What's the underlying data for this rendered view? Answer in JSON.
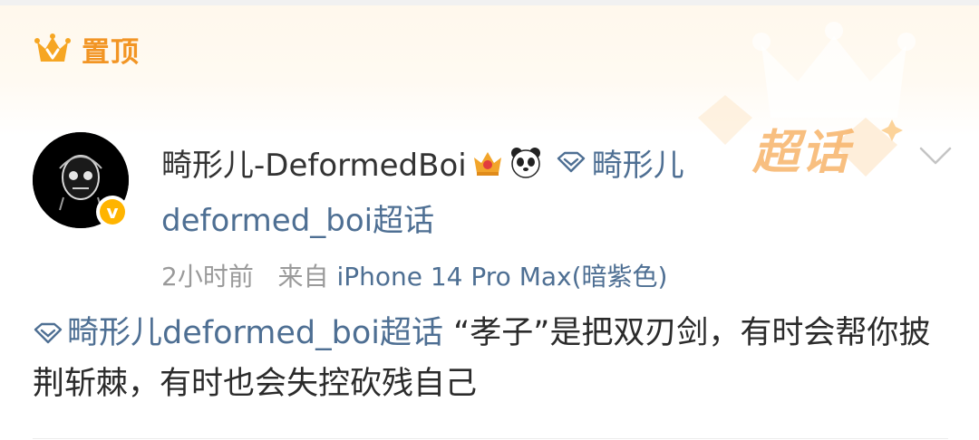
{
  "pin": {
    "label": "置顶"
  },
  "user": {
    "name": "畸形儿-DeformedBoi",
    "topic_part1": "畸形儿",
    "topic_part2": "deformed_boi超话"
  },
  "watermark": {
    "text": "超话"
  },
  "meta": {
    "time": "2小时前",
    "from_label": "来自",
    "device": "iPhone 14 Pro Max(暗紫色)"
  },
  "post": {
    "topic_tag": "畸形儿deformed_boi超话",
    "text": "“孝子”是把双刃剑，有时会帮你披荆斩棘，有时也会失控砍残自己"
  },
  "colors": {
    "accent": "#f29524",
    "link": "#4e6f93",
    "text": "#2b2b2b",
    "meta": "#9a9a9a"
  },
  "icons": [
    "crown-icon",
    "avatar-image",
    "verified-badge-icon",
    "crown-emoji-icon",
    "panda-emoji-icon",
    "topic-diamond-icon",
    "chevron-down-icon"
  ]
}
